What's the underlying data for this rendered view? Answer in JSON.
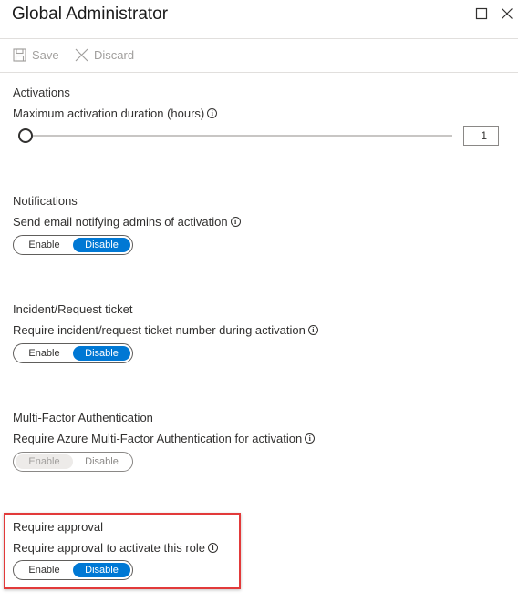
{
  "header": {
    "title": "Global Administrator"
  },
  "toolbar": {
    "save_label": "Save",
    "discard_label": "Discard"
  },
  "activations": {
    "section_title": "Activations",
    "duration_label": "Maximum activation duration (hours)",
    "duration_value": "1"
  },
  "notifications": {
    "section_title": "Notifications",
    "label": "Send email notifying admins of activation",
    "enable_label": "Enable",
    "disable_label": "Disable",
    "selected": "Disable"
  },
  "ticket": {
    "section_title": "Incident/Request ticket",
    "label": "Require incident/request ticket number during activation",
    "enable_label": "Enable",
    "disable_label": "Disable",
    "selected": "Disable"
  },
  "mfa": {
    "section_title": "Multi-Factor Authentication",
    "label": "Require Azure Multi-Factor Authentication for activation",
    "enable_label": "Enable",
    "disable_label": "Disable",
    "selected": "Enable",
    "disabled": true
  },
  "approval": {
    "section_title": "Require approval",
    "label": "Require approval to activate this role",
    "enable_label": "Enable",
    "disable_label": "Disable",
    "selected": "Disable"
  },
  "icons": {
    "maximize": "maximize-icon",
    "close": "close-icon",
    "save": "save-icon",
    "discard": "discard-icon",
    "info": "info-icon"
  },
  "colors": {
    "accent": "#0078d4",
    "highlight": "#e23a3a"
  }
}
